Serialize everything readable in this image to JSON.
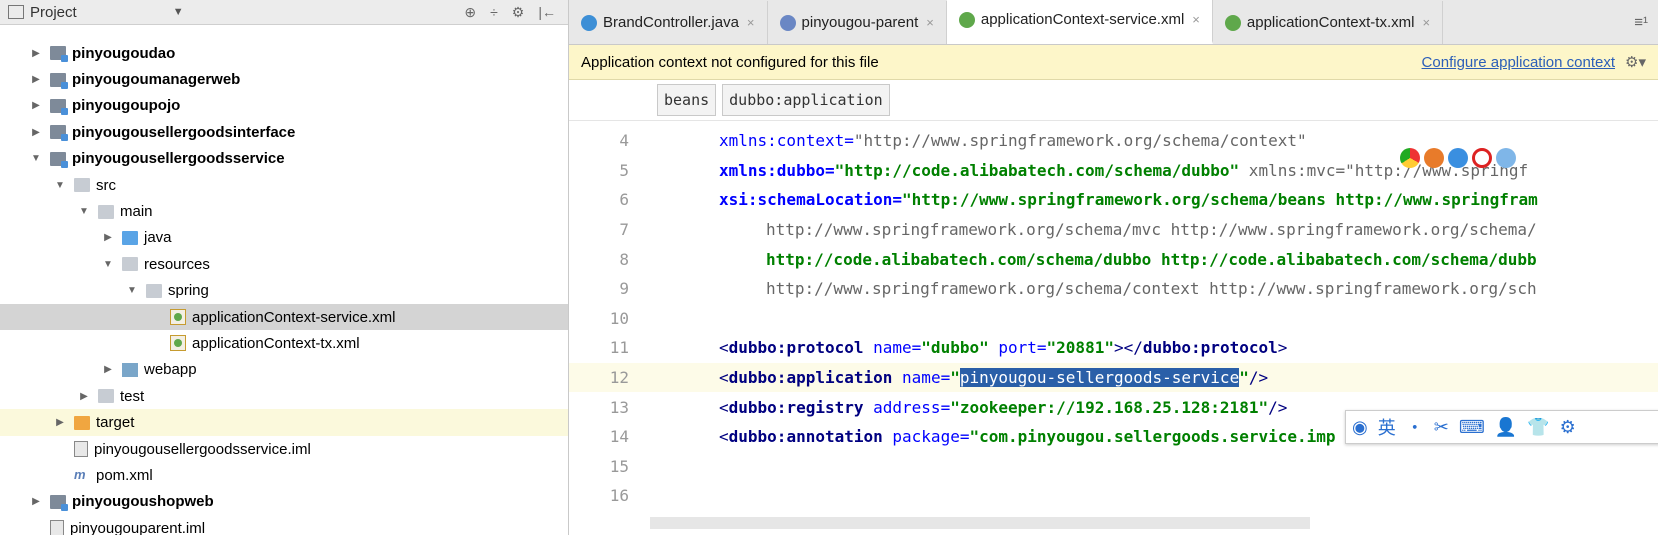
{
  "project_panel": {
    "title": "Project",
    "dropdown": "▼",
    "tools": [
      "⊕",
      "÷",
      "⚙",
      "|←"
    ],
    "tree": [
      {
        "label": "pinyougoudao",
        "depth": 1,
        "arrow": "▶",
        "icon": "module",
        "bold": true
      },
      {
        "label": "pinyougoumanagerweb",
        "depth": 1,
        "arrow": "▶",
        "icon": "module",
        "bold": true
      },
      {
        "label": "pinyougoupojo",
        "depth": 1,
        "arrow": "▶",
        "icon": "module",
        "bold": true
      },
      {
        "label": "pinyougousellergoodsinterface",
        "depth": 1,
        "arrow": "▶",
        "icon": "module",
        "bold": true
      },
      {
        "label": "pinyougousellergoodsservice",
        "depth": 1,
        "arrow": "▼",
        "icon": "module",
        "bold": true
      },
      {
        "label": "src",
        "depth": 2,
        "arrow": "▼",
        "icon": "folder"
      },
      {
        "label": "main",
        "depth": 3,
        "arrow": "▼",
        "icon": "folder"
      },
      {
        "label": "java",
        "depth": 4,
        "arrow": "▶",
        "icon": "folder-blue"
      },
      {
        "label": "resources",
        "depth": 4,
        "arrow": "▼",
        "icon": "folder-res"
      },
      {
        "label": "spring",
        "depth": 5,
        "arrow": "▼",
        "icon": "folder"
      },
      {
        "label": "applicationContext-service.xml",
        "depth": 6,
        "arrow": "",
        "icon": "xml",
        "selected": true
      },
      {
        "label": "applicationContext-tx.xml",
        "depth": 6,
        "arrow": "",
        "icon": "xml"
      },
      {
        "label": "webapp",
        "depth": 4,
        "arrow": "▶",
        "icon": "web"
      },
      {
        "label": "test",
        "depth": 3,
        "arrow": "▶",
        "icon": "folder"
      },
      {
        "label": "target",
        "depth": 2,
        "arrow": "▶",
        "icon": "folder-orange",
        "highlight": true
      },
      {
        "label": "pinyougousellergoodsservice.iml",
        "depth": 2,
        "arrow": "",
        "icon": "iml"
      },
      {
        "label": "pom.xml",
        "depth": 2,
        "arrow": "",
        "icon": "pom"
      },
      {
        "label": "pinyougoushopweb",
        "depth": 1,
        "arrow": "▶",
        "icon": "module",
        "bold": true
      },
      {
        "label": "pinyougouparent.iml",
        "depth": 1,
        "arrow": "",
        "icon": "iml"
      }
    ]
  },
  "tabs": [
    {
      "label": "BrandController.java",
      "close": "×",
      "color": "#3d8fd6"
    },
    {
      "label": "pinyougou-parent",
      "close": "×",
      "color": "#6a87c4"
    },
    {
      "label": "applicationContext-service.xml",
      "close": "×",
      "color": "#5fa84b",
      "active": true
    },
    {
      "label": "applicationContext-tx.xml",
      "close": "×",
      "color": "#5fa84b"
    }
  ],
  "tabs_more": "≡¹",
  "notice": {
    "text": "Application context not configured for this file",
    "link": "Configure application context",
    "gear": "⚙▾"
  },
  "breadcrumbs": [
    "beans",
    "dubbo:application"
  ],
  "code_lines": [
    {
      "n": "4",
      "segments": [
        [
          "attr",
          "xmlns:context="
        ],
        [
          "strp",
          "\"http://www.springframework.org/schema/context\""
        ]
      ]
    },
    {
      "n": "5",
      "segments": [
        [
          "attrb",
          "xmlns:dubbo="
        ],
        [
          "str",
          "\"http://code.alibabatech.com/schema/dubbo\""
        ],
        [
          "grey",
          " xmlns:mvc=\"http://www.springf"
        ]
      ]
    },
    {
      "n": "6",
      "segments": [
        [
          "attrb",
          "xsi:schemaLocation="
        ],
        [
          "str",
          "\"http://www.springframework.org/schema/beans http://www.springfram"
        ]
      ]
    },
    {
      "n": "7",
      "indent": true,
      "segments": [
        [
          "grey",
          "http://www.springframework.org/schema/mvc http://www.springframework.org/schema/"
        ]
      ]
    },
    {
      "n": "8",
      "indent": true,
      "segments": [
        [
          "grn",
          "http://code.alibabatech.com/schema/dubbo http://code.alibabatech.com/schema/dubb"
        ]
      ]
    },
    {
      "n": "9",
      "indent": true,
      "segments": [
        [
          "grey",
          "http://www.springframework.org/schema/context http://www.springframework.org/sch"
        ]
      ]
    },
    {
      "n": "10",
      "segments": []
    },
    {
      "n": "11",
      "segments": [
        [
          "tagb",
          "<"
        ],
        [
          "tag",
          "dubbo:protocol"
        ],
        [
          "attr",
          " name="
        ],
        [
          "str",
          "\"dubbo\""
        ],
        [
          "attr",
          " port="
        ],
        [
          "str",
          "\"20881\""
        ],
        [
          "tagb",
          "></"
        ],
        [
          "tag",
          "dubbo:protocol"
        ],
        [
          "tagb",
          ">"
        ]
      ]
    },
    {
      "n": "12",
      "current": true,
      "segments": [
        [
          "tagb",
          "<"
        ],
        [
          "tag",
          "dubbo:application"
        ],
        [
          "attr",
          " name="
        ],
        [
          "str",
          "\""
        ],
        [
          "selbg",
          "pinyougou-sellergoods-service"
        ],
        [
          "str",
          "\""
        ],
        [
          "tagb",
          "/>"
        ]
      ]
    },
    {
      "n": "13",
      "segments": [
        [
          "tagb",
          "<"
        ],
        [
          "tag",
          "dubbo:registry"
        ],
        [
          "attr",
          " address="
        ],
        [
          "str",
          "\"zookeeper://192.168.25.128:2181\""
        ],
        [
          "tagb",
          "/>"
        ]
      ]
    },
    {
      "n": "14",
      "segments": [
        [
          "tagb",
          "<"
        ],
        [
          "tag",
          "dubbo:annotation"
        ],
        [
          "attr",
          " package="
        ],
        [
          "str",
          "\"com.pinyougou.sellergoods.service.imp"
        ]
      ]
    },
    {
      "n": "15",
      "segments": []
    },
    {
      "n": "16",
      "segments": []
    }
  ],
  "ime_toolbar": [
    "◉",
    "英",
    "・",
    "✂",
    "⌨",
    "👤",
    "👕",
    "⚙"
  ]
}
